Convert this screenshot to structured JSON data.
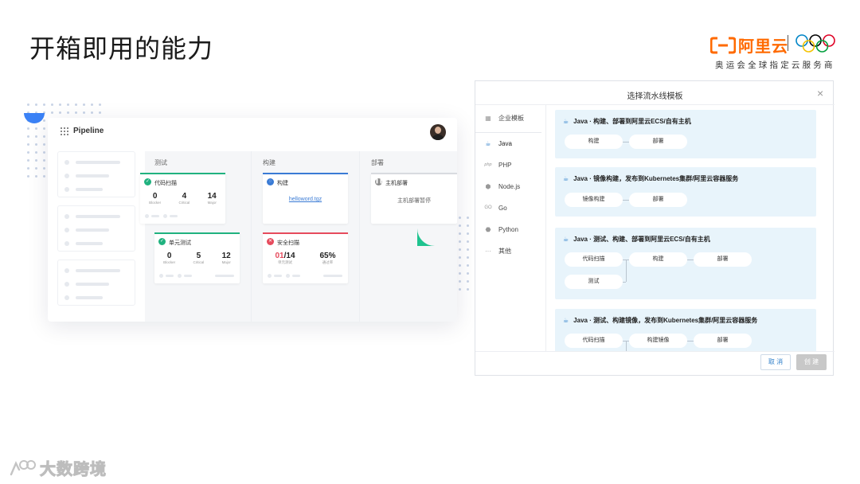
{
  "slide": {
    "title": "开箱即用的能力"
  },
  "brand": {
    "name": "阿里云",
    "subtitle": "奥运会全球指定云服务商",
    "colors": {
      "orange": "#ff6a00",
      "rings": [
        "#0085c7",
        "#f4c300",
        "#000000",
        "#009f3d",
        "#df0024"
      ]
    }
  },
  "pipeline": {
    "title": "Pipeline",
    "stages": [
      {
        "label": "测试",
        "jobs": [
          {
            "name": "代码扫描",
            "status": "success",
            "metrics": [
              {
                "value": "0",
                "label": "Blocker"
              },
              {
                "value": "4",
                "label": "Critical"
              },
              {
                "value": "14",
                "label": "Major"
              }
            ]
          },
          {
            "name": "单元测试",
            "status": "success",
            "metrics": [
              {
                "value": "0",
                "label": "Blocker"
              },
              {
                "value": "5",
                "label": "Critical"
              },
              {
                "value": "12",
                "label": "Major"
              }
            ]
          }
        ]
      },
      {
        "label": "构建",
        "jobs": [
          {
            "name": "构建",
            "status": "running",
            "link": "helloword.tgz"
          },
          {
            "name": "安全扫描",
            "status": "failed",
            "metrics": [
              {
                "value_fail": "01",
                "value_total": "/14",
                "label": "单元测试"
              },
              {
                "value": "65%",
                "label": "通过率"
              }
            ]
          }
        ]
      },
      {
        "label": "部署",
        "jobs": [
          {
            "name": "主机部署",
            "status": "paused",
            "note": "主机部署暂停"
          }
        ]
      }
    ],
    "colors": {
      "success": "#20b27f",
      "running": "#3a7bd5",
      "failed": "#e64b5d",
      "paused": "#8c8c8c"
    }
  },
  "dialog": {
    "title": "选择流水线模板",
    "nav": [
      {
        "icon": "grid-icon",
        "label": "企业模板"
      },
      {
        "icon": "java-icon",
        "label": "Java"
      },
      {
        "icon": "php-icon",
        "label": "PHP"
      },
      {
        "icon": "nodejs-icon",
        "label": "Node.js"
      },
      {
        "icon": "go-icon",
        "label": "Go"
      },
      {
        "icon": "python-icon",
        "label": "Python"
      },
      {
        "icon": "more-icon",
        "label": "其他"
      }
    ],
    "templates": [
      {
        "title": "Java · 构建、部署到阿里云ECS/自有主机",
        "steps": [
          "构建",
          "部署"
        ]
      },
      {
        "title": "Java · 镜像构建，发布到Kubernetes集群/阿里云容器服务",
        "steps": [
          "镜像构建",
          "部署"
        ]
      },
      {
        "title": "Java · 测试、构建、部署到阿里云ECS/自有主机",
        "steps": [
          "代码扫描",
          "构建",
          "部署",
          "测试"
        ]
      },
      {
        "title": "Java · 测试、构建镜像，发布到Kubernetes集群/阿里云容器服务",
        "steps": [
          "代码扫描",
          "构建镜像",
          "部署"
        ]
      }
    ],
    "buttons": {
      "cancel": "取 消",
      "create": "创 建"
    }
  },
  "watermark": {
    "text": "大数跨境"
  }
}
